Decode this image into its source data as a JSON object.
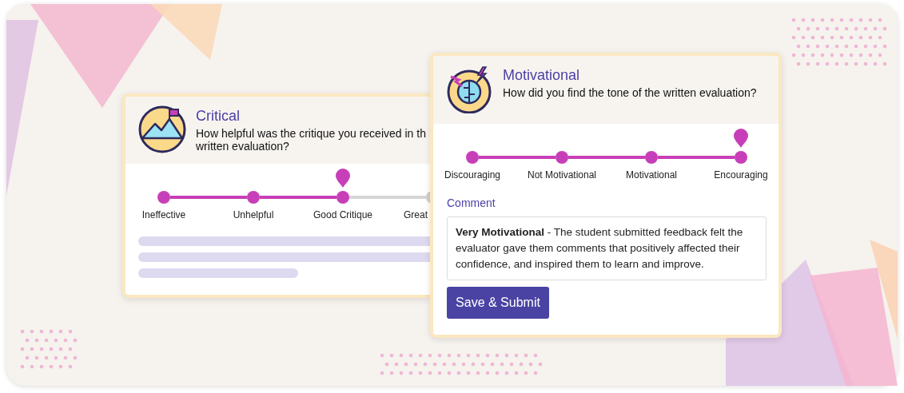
{
  "cards": [
    {
      "title": "Critical",
      "question_lines": [
        "How helpful was the critique you received in th",
        "written evaluation?"
      ],
      "options": [
        {
          "label": "Ineffective",
          "selected": false
        },
        {
          "label": "Unhelpful",
          "selected": false
        },
        {
          "label": "Good Critique",
          "selected": true
        },
        {
          "label": "Great",
          "selected": false
        }
      ]
    },
    {
      "title": "Motivational",
      "question_lines": [
        "How did you find the tone of the written evaluation?"
      ],
      "options": [
        {
          "label": "Discouraging",
          "selected": false
        },
        {
          "label": "Not Motivational",
          "selected": false
        },
        {
          "label": "Motivational",
          "selected": false
        },
        {
          "label": "Encouraging",
          "selected": true
        }
      ],
      "comment": {
        "label": "Comment",
        "value": "**Very Motivational** - The student submitted feedback felt the evaluator gave them comments that positively affected their confidence, and inspired them to learn and improve."
      },
      "button": "Save & Submit"
    }
  ]
}
